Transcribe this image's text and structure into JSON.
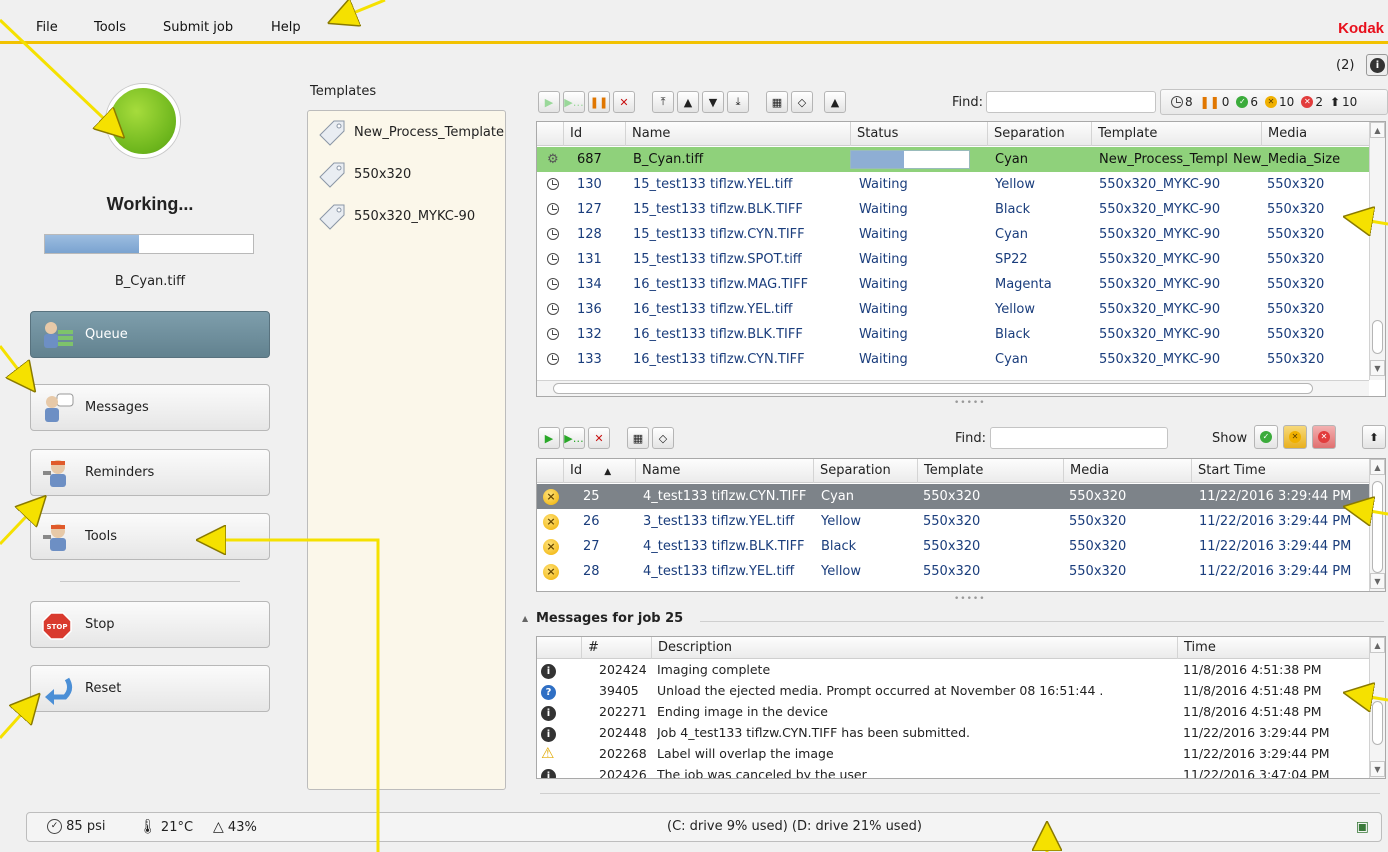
{
  "menu": [
    "File",
    "Tools",
    "Submit job",
    "Help"
  ],
  "brand": "Kodak",
  "notification": {
    "count_label": "(2)"
  },
  "status": {
    "label": "Working...",
    "current_file": "B_Cyan.tiff",
    "progress_fraction": 0.45
  },
  "nav": {
    "queue": "Queue",
    "messages": "Messages",
    "reminders": "Reminders",
    "tools": "Tools",
    "stop": "Stop",
    "reset": "Reset"
  },
  "templates": {
    "title": "Templates",
    "items": [
      "New_Process_Template",
      "550x320",
      "550x320_MYKC-90"
    ]
  },
  "queue_toolbar": {
    "find_label": "Find:"
  },
  "counts": {
    "waiting": "8",
    "paused": "0",
    "done": "6",
    "canceled": "10",
    "failed": "2",
    "up": "10"
  },
  "queue_table": {
    "columns": [
      "Id",
      "Name",
      "Status",
      "Separation",
      "Template",
      "Media"
    ],
    "active_row": {
      "id": "687",
      "name": "B_Cyan.tiff",
      "progress_fraction": 0.45,
      "separation": "Cyan",
      "template": "New_Process_Templ",
      "media": "New_Media_Size"
    },
    "rows": [
      {
        "id": "130",
        "name": "15_test133 tiflzw.YEL.tiff",
        "status": "Waiting",
        "separation": "Yellow",
        "template": "550x320_MYKC-90",
        "media": "550x320"
      },
      {
        "id": "127",
        "name": "15_test133 tiflzw.BLK.TIFF",
        "status": "Waiting",
        "separation": "Black",
        "template": "550x320_MYKC-90",
        "media": "550x320"
      },
      {
        "id": "128",
        "name": "15_test133 tiflzw.CYN.TIFF",
        "status": "Waiting",
        "separation": "Cyan",
        "template": "550x320_MYKC-90",
        "media": "550x320"
      },
      {
        "id": "131",
        "name": "15_test133 tiflzw.SPOT.tiff",
        "status": "Waiting",
        "separation": "SP22",
        "template": "550x320_MYKC-90",
        "media": "550x320"
      },
      {
        "id": "134",
        "name": "16_test133 tiflzw.MAG.TIFF",
        "status": "Waiting",
        "separation": "Magenta",
        "template": "550x320_MYKC-90",
        "media": "550x320"
      },
      {
        "id": "136",
        "name": "16_test133 tiflzw.YEL.tiff",
        "status": "Waiting",
        "separation": "Yellow",
        "template": "550x320_MYKC-90",
        "media": "550x320"
      },
      {
        "id": "132",
        "name": "16_test133 tiflzw.BLK.TIFF",
        "status": "Waiting",
        "separation": "Black",
        "template": "550x320_MYKC-90",
        "media": "550x320"
      },
      {
        "id": "133",
        "name": "16_test133 tiflzw.CYN.TIFF",
        "status": "Waiting",
        "separation": "Cyan",
        "template": "550x320_MYKC-90",
        "media": "550x320"
      }
    ]
  },
  "history_toolbar": {
    "find_label": "Find:",
    "show_label": "Show"
  },
  "history_table": {
    "columns": [
      "Id",
      "Name",
      "Separation",
      "Template",
      "Media",
      "Start Time"
    ],
    "rows": [
      {
        "id": "25",
        "name": "4_test133 tiflzw.CYN.TIFF",
        "separation": "Cyan",
        "template": "550x320",
        "media": "550x320",
        "start": "11/22/2016 3:29:44 PM"
      },
      {
        "id": "26",
        "name": "3_test133 tiflzw.YEL.tiff",
        "separation": "Yellow",
        "template": "550x320",
        "media": "550x320",
        "start": "11/22/2016 3:29:44 PM"
      },
      {
        "id": "27",
        "name": "4_test133 tiflzw.BLK.TIFF",
        "separation": "Black",
        "template": "550x320",
        "media": "550x320",
        "start": "11/22/2016 3:29:44 PM"
      },
      {
        "id": "28",
        "name": "4_test133 tiflzw.YEL.tiff",
        "separation": "Yellow",
        "template": "550x320",
        "media": "550x320",
        "start": "11/22/2016 3:29:44 PM"
      }
    ]
  },
  "messages": {
    "title": "Messages for job 25",
    "columns": [
      "#",
      "Description",
      "Time"
    ],
    "rows": [
      {
        "type": "info",
        "num": "202424",
        "desc": "Imaging complete",
        "time": "11/8/2016 4:51:38 PM"
      },
      {
        "type": "question",
        "num": "39405",
        "desc": "Unload the ejected media.  Prompt occurred at November 08 16:51:44 .",
        "time": "11/8/2016 4:51:48 PM"
      },
      {
        "type": "info",
        "num": "202271",
        "desc": "Ending image in the device",
        "time": "11/8/2016 4:51:48 PM"
      },
      {
        "type": "info",
        "num": "202448",
        "desc": "Job 4_test133 tiflzw.CYN.TIFF has been submitted.",
        "time": "11/22/2016 3:29:44 PM"
      },
      {
        "type": "warning",
        "num": "202268",
        "desc": "Label will overlap the image",
        "time": "11/22/2016 3:29:44 PM"
      },
      {
        "type": "info",
        "num": "202426",
        "desc": "The job was canceled by the user",
        "time": "11/22/2016 3:47:04 PM"
      }
    ]
  },
  "statusbar": {
    "pressure": "85 psi",
    "temperature": "21°C",
    "humidity": "43%",
    "drives": "(C: drive 9% used) (D: drive 21% used)"
  },
  "colors": {
    "accent_yellow": "#f2c200",
    "brand_red": "#e8101c",
    "active_row": "#8fd17b",
    "selected_row": "#7d8389"
  }
}
